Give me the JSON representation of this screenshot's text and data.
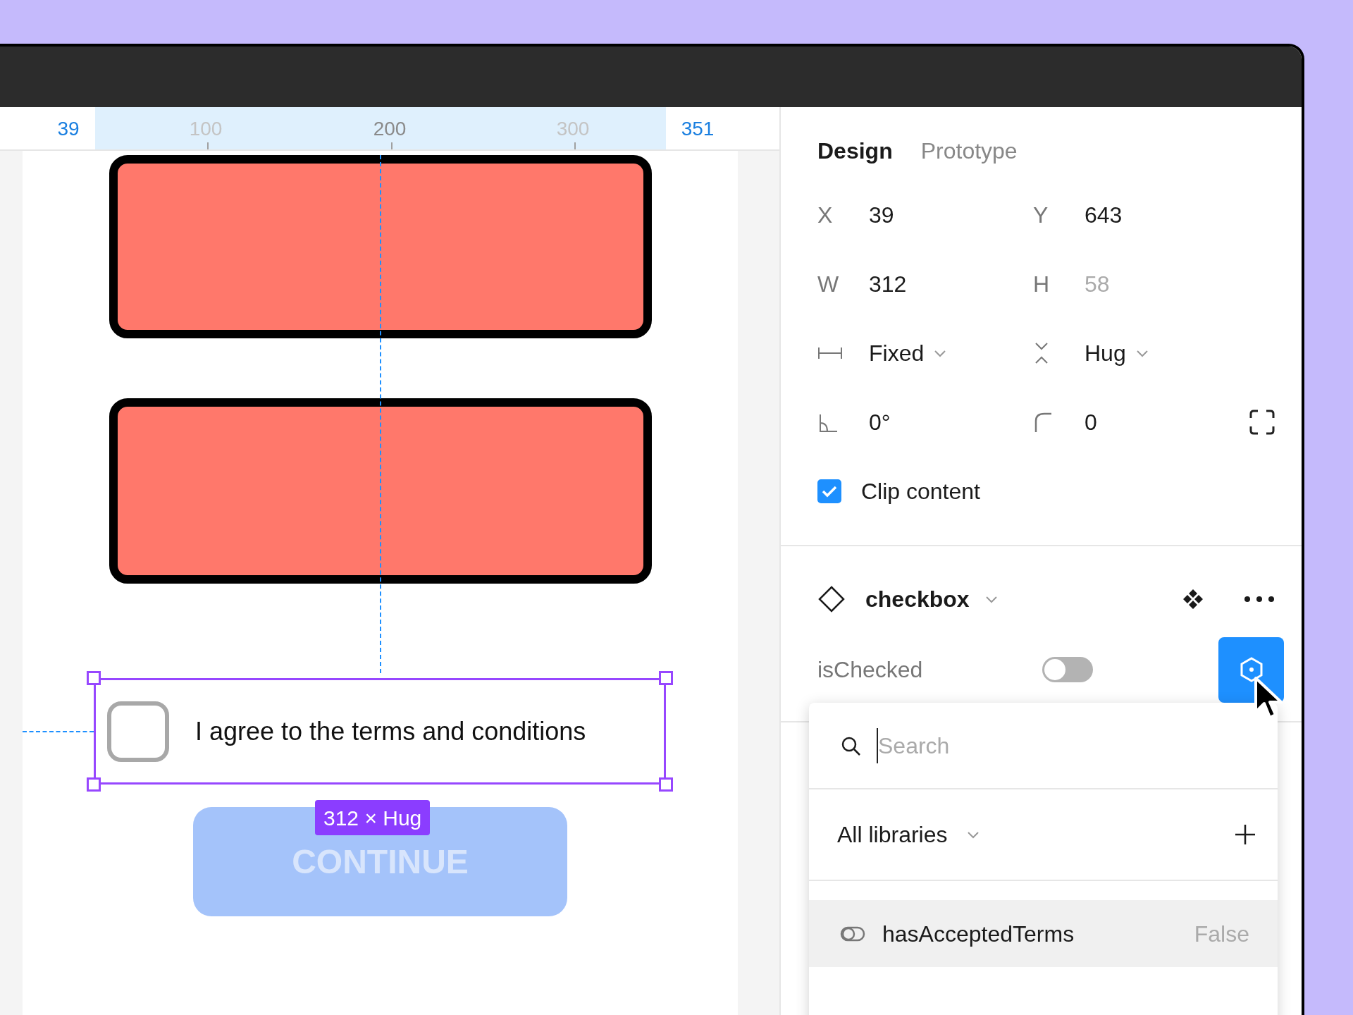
{
  "ruler": [
    {
      "text": "39",
      "kind": "bound"
    },
    {
      "text": "100",
      "kind": "minor"
    },
    {
      "text": "200",
      "kind": "major"
    },
    {
      "text": "300",
      "kind": "minor"
    },
    {
      "text": "351",
      "kind": "bound"
    }
  ],
  "canvas": {
    "checkbox_row": {
      "label": "I agree to the terms and conditions",
      "checked": false
    },
    "size_badge": "312 × Hug",
    "button": {
      "label": "CONTINUE",
      "disabled": true
    }
  },
  "tabs": [
    {
      "label": "Design",
      "selected": true
    },
    {
      "label": "Prototype",
      "selected": false
    }
  ],
  "fields": [
    {
      "label": "X",
      "value": "39",
      "disabled": false
    },
    {
      "label": "Y",
      "value": "643",
      "disabled": false
    },
    {
      "label": "W",
      "value": "312",
      "disabled": false
    },
    {
      "label": "H",
      "value": "58",
      "disabled": true
    }
  ],
  "sizing": [
    {
      "kind": "width",
      "value": "Fixed"
    },
    {
      "kind": "height",
      "value": "Hug"
    }
  ],
  "rotation": "0°",
  "radius": "0",
  "clip_content": {
    "label": "Clip content",
    "checked": true
  },
  "component": {
    "name": "checkbox"
  },
  "property": {
    "label": "isChecked",
    "on": false
  },
  "dropdown": {
    "placeholder": "Search",
    "library": "All libraries",
    "items": [
      {
        "name": "hasAcceptedTerms",
        "value": "False",
        "selected": true
      }
    ]
  }
}
